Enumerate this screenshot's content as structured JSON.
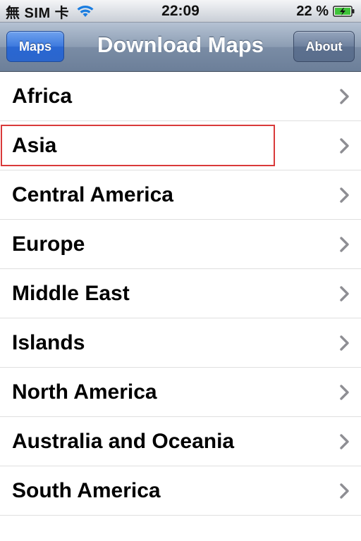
{
  "status_bar": {
    "carrier": "無 SIM 卡",
    "time": "22:09",
    "battery_percent": "22 %",
    "battery_charging": true,
    "icons": {
      "wifi": "wifi-icon",
      "battery": "battery-charging-icon"
    }
  },
  "nav_bar": {
    "left_button": "Maps",
    "title": "Download Maps",
    "right_button": "About"
  },
  "regions": [
    {
      "label": "Africa",
      "accessory": "chevron-right-icon"
    },
    {
      "label": "Asia",
      "accessory": "chevron-right-icon",
      "highlighted": true
    },
    {
      "label": "Central America",
      "accessory": "chevron-right-icon"
    },
    {
      "label": "Europe",
      "accessory": "chevron-right-icon"
    },
    {
      "label": "Middle East",
      "accessory": "chevron-right-icon"
    },
    {
      "label": "Islands",
      "accessory": "chevron-right-icon"
    },
    {
      "label": "North America",
      "accessory": "chevron-right-icon"
    },
    {
      "label": "Australia and Oceania",
      "accessory": "chevron-right-icon"
    },
    {
      "label": "South America",
      "accessory": "chevron-right-icon"
    }
  ],
  "colors": {
    "nav_bar": "#7a8ca5",
    "maps_button": "#3d79de",
    "about_button": "#6e819e",
    "highlight": "#d93a3a",
    "chevron": "#8e8e93",
    "battery_fill": "#3fc23a"
  }
}
